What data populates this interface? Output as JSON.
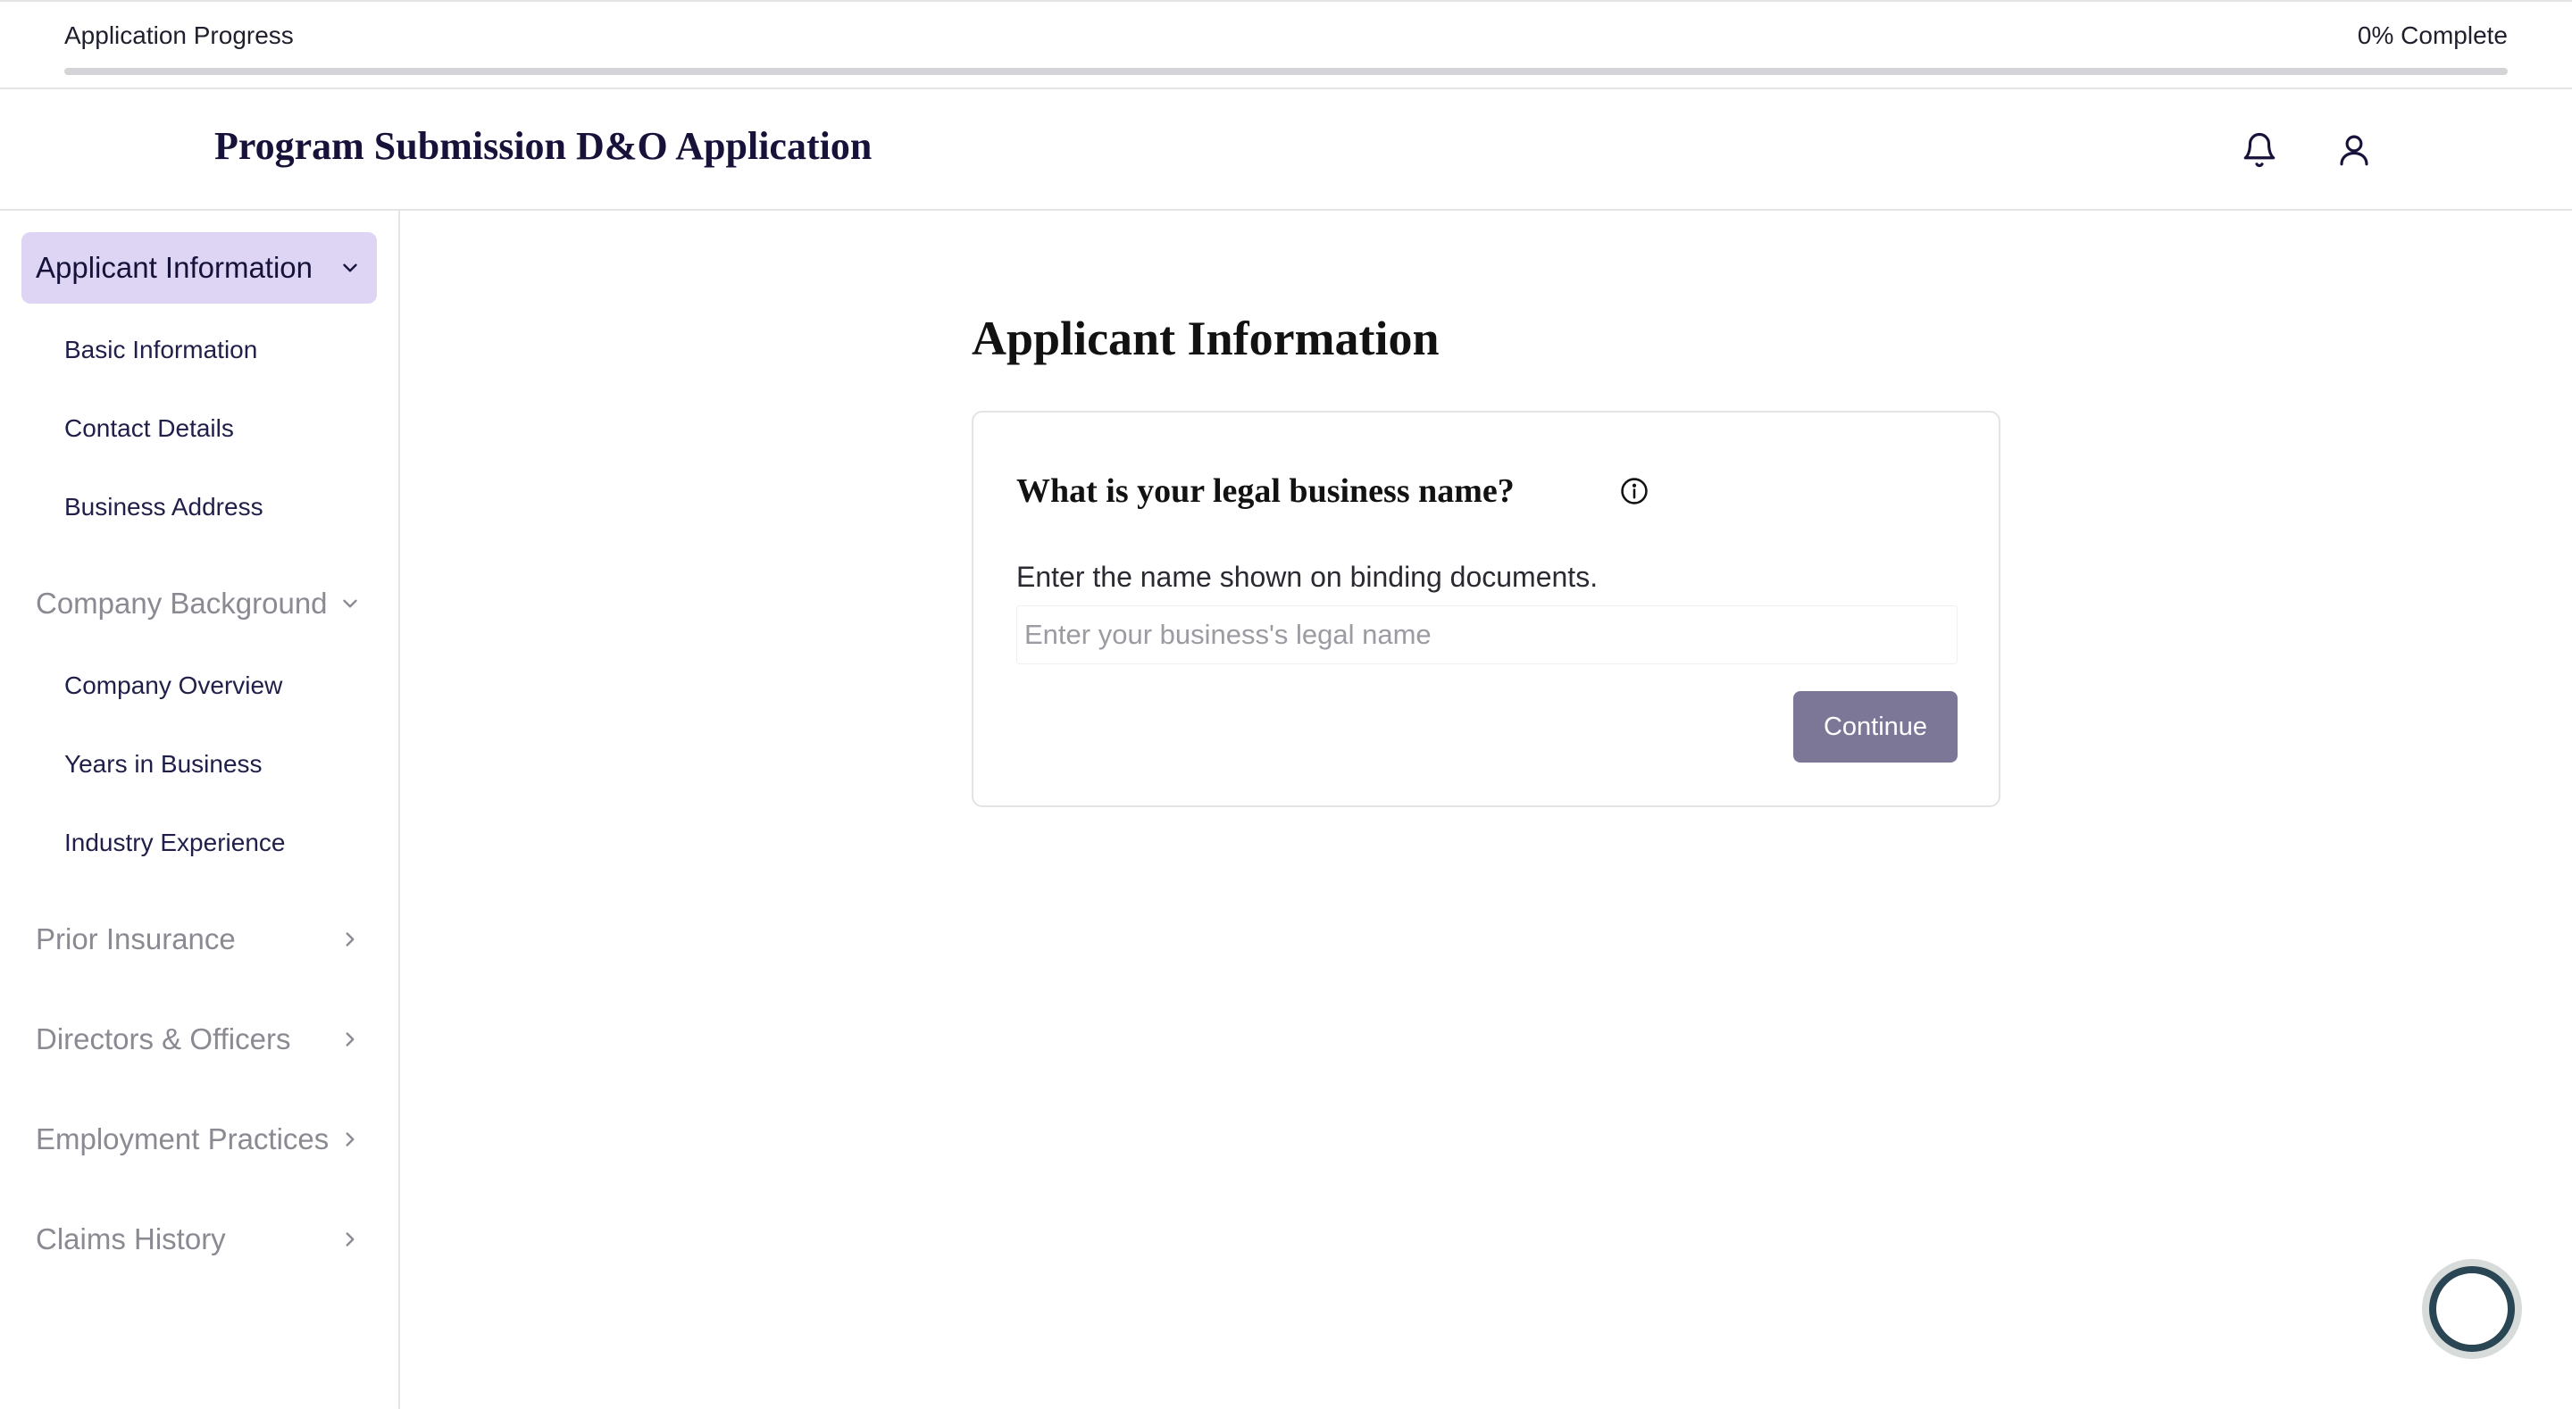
{
  "progress": {
    "label": "Application Progress",
    "percent_text": "0% Complete",
    "value": 0
  },
  "header": {
    "title": "Program Submission D&O Application",
    "icons": [
      "bell-icon",
      "user-icon"
    ]
  },
  "sidebar": {
    "sections": [
      {
        "label": "Applicant Information",
        "state": "expanded",
        "active": true,
        "items": [
          "Basic Information",
          "Contact Details",
          "Business Address"
        ]
      },
      {
        "label": "Company Background",
        "state": "expanded",
        "active": false,
        "items": [
          "Company Overview",
          "Years in Business",
          "Industry Experience"
        ]
      },
      {
        "label": "Prior Insurance",
        "state": "collapsed",
        "active": false
      },
      {
        "label": "Directors & Officers",
        "state": "collapsed",
        "active": false
      },
      {
        "label": "Employment Practices",
        "state": "collapsed",
        "active": false
      },
      {
        "label": "Claims History",
        "state": "collapsed",
        "active": false
      }
    ]
  },
  "main": {
    "heading": "Applicant Information",
    "card": {
      "question": "What is your legal business name?",
      "field_label": "Enter the name shown on binding documents.",
      "input_value": "",
      "input_placeholder": "Enter your business's legal name",
      "continue_label": "Continue"
    }
  },
  "colors": {
    "brand_navy": "#17123a",
    "active_section_bg": "#ddd5f3",
    "button_bg": "#7d7797",
    "help_ring": "#2a4553"
  }
}
